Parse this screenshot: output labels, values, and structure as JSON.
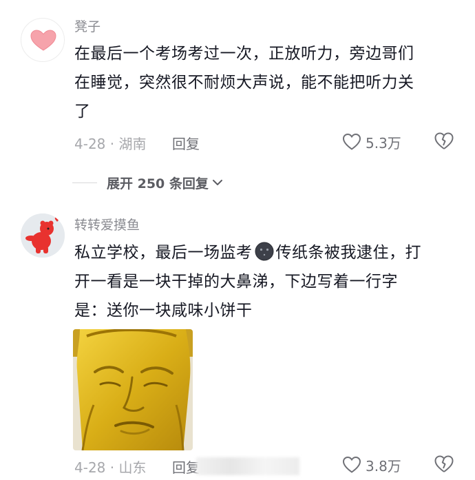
{
  "comments": [
    {
      "username": "凳子",
      "text_lines": [
        "在最后一个考场考过一次，正放听力，旁边哥们",
        "在睡觉，突然很不耐烦大声说，能不能把听力关",
        "了"
      ],
      "date_location": "4-28 · 湖南",
      "reply_label": "回复",
      "like_count": "5.3万",
      "avatar_icon": "heart-icon"
    },
    {
      "username": "转转爱摸鱼",
      "text_line1_a": "私立学校，最后一场监考",
      "text_line1_b": "传纸条被我逮住，打",
      "text_lines_rest": [
        "开一看是一块干掉的大鼻涕，下边写着一行字",
        "是：送你一块咸味小饼干"
      ],
      "date_location": "4-28 · 山东",
      "reply_label": "回复",
      "like_count": "3.8万",
      "avatar_icon": "red-bear-icon"
    }
  ],
  "expand_replies": {
    "label": "展开 250 条回复"
  },
  "colors": {
    "accent_heart": "#f4707b",
    "bear": "#e8322f"
  }
}
